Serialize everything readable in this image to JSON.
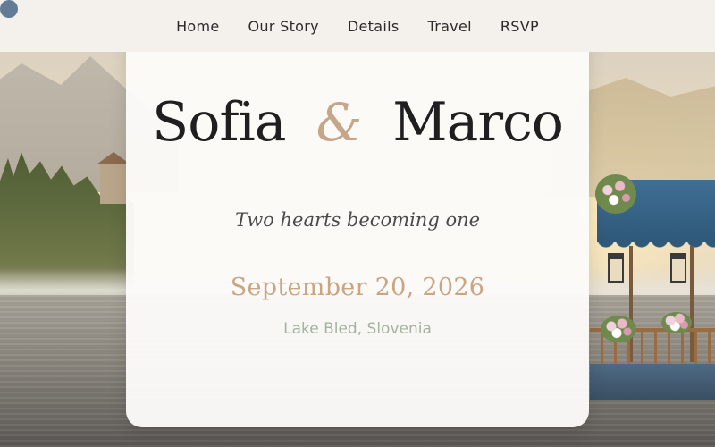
{
  "nav": {
    "items": [
      {
        "label": "Home"
      },
      {
        "label": "Our Story"
      },
      {
        "label": "Details"
      },
      {
        "label": "Travel"
      },
      {
        "label": "RSVP"
      }
    ]
  },
  "hero": {
    "name_one": "Sofia",
    "ampersand": "&",
    "name_two": "Marco",
    "tagline": "Two hearts becoming one",
    "date": "September 20, 2026",
    "location": "Lake Bled, Slovenia"
  },
  "colors": {
    "accent": "#c9a582",
    "location_text": "#a3b3a0",
    "nav_bg": "#f4f1ec",
    "corner_dot": "#647b95"
  }
}
